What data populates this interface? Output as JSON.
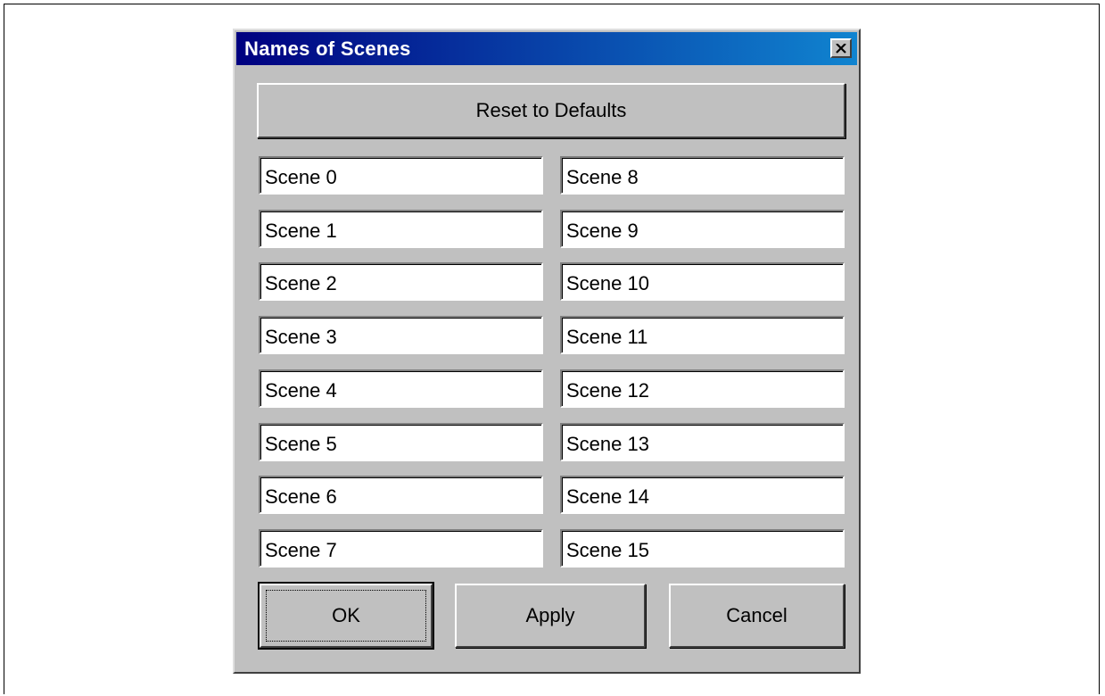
{
  "dialog": {
    "title": "Names of Scenes",
    "close_icon": "close-icon",
    "reset_label": "Reset to Defaults",
    "ok_label": "OK",
    "apply_label": "Apply",
    "cancel_label": "Cancel"
  },
  "scenes_left": [
    "Scene 0",
    "Scene 1",
    "Scene 2",
    "Scene 3",
    "Scene 4",
    "Scene 5",
    "Scene 6",
    "Scene 7"
  ],
  "scenes_right": [
    "Scene 8",
    "Scene 9",
    "Scene 10",
    "Scene 11",
    "Scene 12",
    "Scene 13",
    "Scene 14",
    "Scene 15"
  ],
  "colors": {
    "titlebar_start": "#000080",
    "titlebar_end": "#1084d0",
    "face": "#c0c0c0"
  }
}
